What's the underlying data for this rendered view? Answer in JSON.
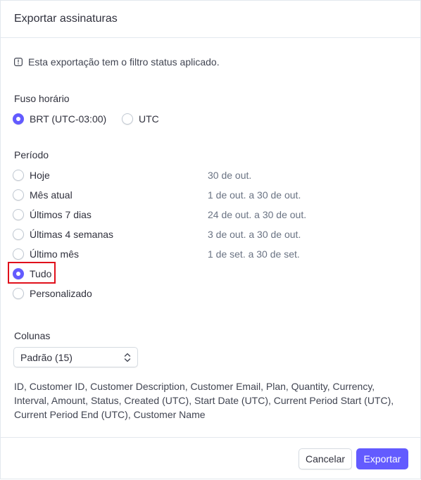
{
  "dialog": {
    "title": "Exportar assinaturas",
    "notice": "Esta exportação tem o filtro status aplicado."
  },
  "timezone": {
    "label": "Fuso horário",
    "options": [
      {
        "label": "BRT (UTC-03:00)",
        "checked": true
      },
      {
        "label": "UTC",
        "checked": false
      }
    ]
  },
  "period": {
    "label": "Período",
    "options": [
      {
        "label": "Hoje",
        "range": "30 de out.",
        "checked": false
      },
      {
        "label": "Mês atual",
        "range": "1 de out. a 30 de out.",
        "checked": false
      },
      {
        "label": "Últimos 7 dias",
        "range": "24 de out. a 30 de out.",
        "checked": false
      },
      {
        "label": "Últimas 4 semanas",
        "range": "3 de out. a 30 de out.",
        "checked": false
      },
      {
        "label": "Último mês",
        "range": "1 de set. a 30 de set.",
        "checked": false
      },
      {
        "label": "Tudo",
        "range": "",
        "checked": true
      },
      {
        "label": "Personalizado",
        "range": "",
        "checked": false
      }
    ]
  },
  "columns": {
    "label": "Colunas",
    "selected": "Padrão (15)",
    "list": "ID, Customer ID, Customer Description, Customer Email, Plan, Quantity, Currency, Interval, Amount, Status, Created (UTC), Start Date (UTC), Current Period Start (UTC), Current Period End (UTC), Customer Name"
  },
  "footer": {
    "cancel_label": "Cancelar",
    "export_label": "Exportar"
  },
  "colors": {
    "accent": "#635bff",
    "highlight": "#e0101b",
    "muted_text": "#6a7383"
  },
  "icons": {
    "notice": "info-icon",
    "select": "chevron-up-down-icon"
  }
}
